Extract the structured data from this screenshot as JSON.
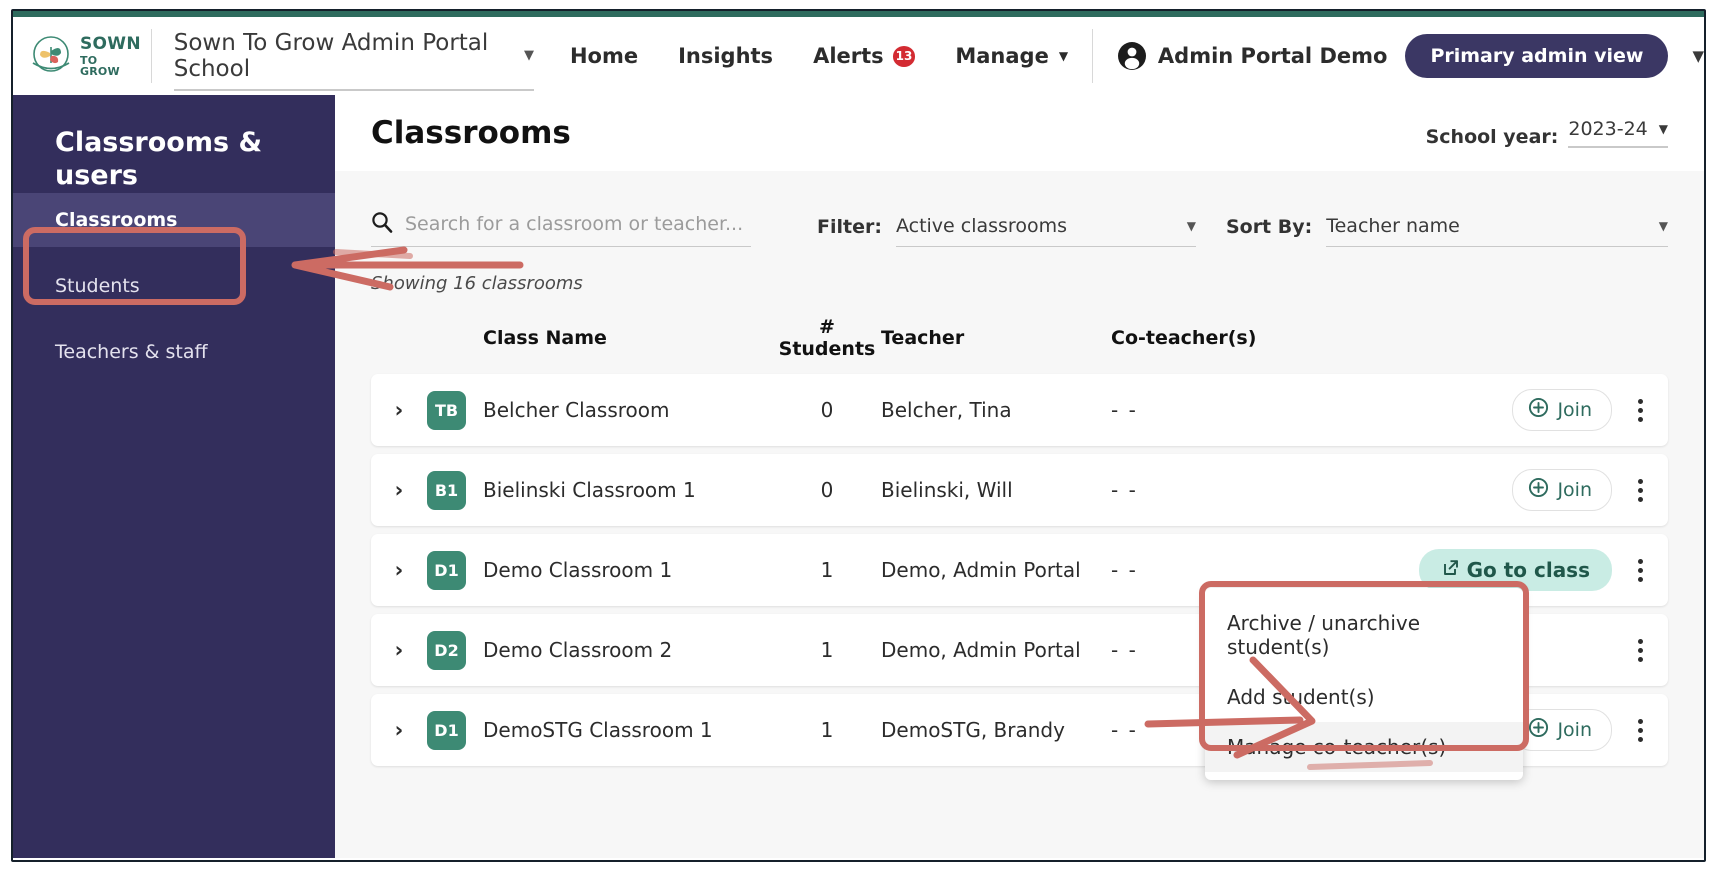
{
  "topnav": {
    "logo": {
      "line1": "SOWN",
      "line2": "TO GROW",
      "icon": "sown-to-grow-logo"
    },
    "school_selector": "Sown To Grow Admin Portal School",
    "links": [
      {
        "label": "Home",
        "badge": "",
        "caret": false
      },
      {
        "label": "Insights",
        "badge": "",
        "caret": false
      },
      {
        "label": "Alerts",
        "badge": "13",
        "caret": false
      },
      {
        "label": "Manage",
        "badge": "",
        "caret": true
      }
    ],
    "user_name": "Admin Portal Demo",
    "primary_view_button": "Primary admin view",
    "caret_glyph": "▼"
  },
  "sidebar": {
    "title": "Classrooms & users",
    "items": [
      {
        "label": "Classrooms",
        "active": true
      },
      {
        "label": "Students",
        "active": false
      },
      {
        "label": "Teachers & staff",
        "active": false
      }
    ]
  },
  "main": {
    "page_title": "Classrooms",
    "school_year": {
      "label": "School year:",
      "value": "2023-24"
    },
    "search": {
      "placeholder": "Search for a classroom or teacher...",
      "value": "",
      "icon": "search-icon"
    },
    "filter": {
      "label": "Filter:",
      "value": "Active classrooms"
    },
    "sort_by": {
      "label": "Sort By:",
      "value": "Teacher name"
    },
    "showing": "Showing 16 classrooms",
    "columns": [
      "Class Name",
      "# Students",
      "Teacher",
      "Co-teacher(s)"
    ],
    "rows": [
      {
        "initials": "TB",
        "name": "Belcher Classroom",
        "students": "0",
        "teacher": "Belcher, Tina",
        "coteachers": "- -",
        "action": "join",
        "action_label": "Join"
      },
      {
        "initials": "B1",
        "name": "Bielinski Classroom 1",
        "students": "0",
        "teacher": "Bielinski, Will",
        "coteachers": "- -",
        "action": "join",
        "action_label": "Join"
      },
      {
        "initials": "D1",
        "name": "Demo Classroom 1",
        "students": "1",
        "teacher": "Demo, Admin Portal",
        "coteachers": "- -",
        "action": "goto",
        "action_label": "Go to class"
      },
      {
        "initials": "D2",
        "name": "Demo Classroom 2",
        "students": "1",
        "teacher": "Demo, Admin Portal",
        "coteachers": "- -",
        "action": "none",
        "action_label": ""
      },
      {
        "initials": "D1",
        "name": "DemoSTG Classroom 1",
        "students": "1",
        "teacher": "DemoSTG, Brandy",
        "coteachers": "- -",
        "action": "join",
        "action_label": "Join"
      }
    ]
  },
  "context_menu": {
    "items": [
      {
        "label": "Archive / unarchive student(s)",
        "hover": false
      },
      {
        "label": "Add student(s)",
        "hover": false
      },
      {
        "label": "Manage co-teacher(s)",
        "hover": true
      }
    ]
  },
  "colors": {
    "brand_green": "#2e6b5e",
    "sidebar_purple": "#332e5c",
    "sidebar_active": "#4a4576",
    "primary_pill": "#3b3764",
    "avatar_green": "#3d8a74",
    "goto_bg": "#c9ece4",
    "alert_red": "#d32b32",
    "annotation_red": "#cc6b63"
  }
}
